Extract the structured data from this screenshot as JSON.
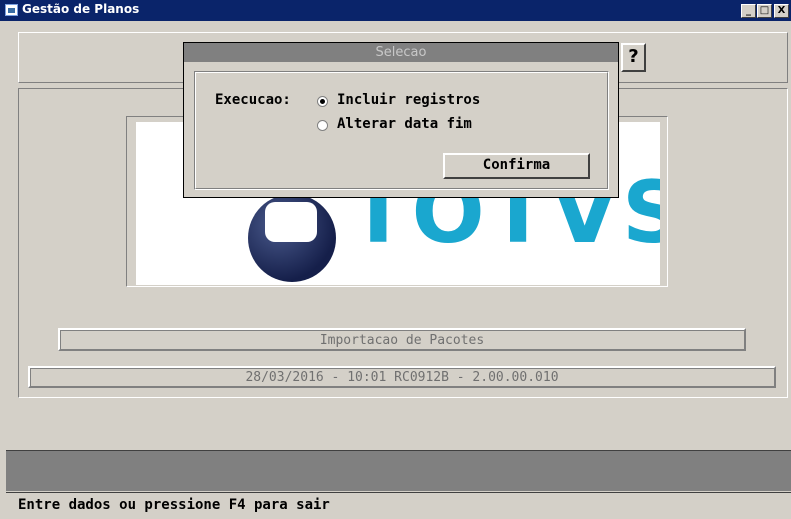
{
  "window": {
    "title": "Gestão de Planos",
    "controls": {
      "minimize": "_",
      "maximize": "□",
      "close": "X"
    }
  },
  "help_button": {
    "label": "?"
  },
  "main": {
    "logo_text": "TOTVS",
    "info_text": "Importacao de Pacotes",
    "version_text": "28/03/2016 - 10:01  RC0912B - 2.00.00.010"
  },
  "dialog": {
    "title": "Selecao",
    "field_label": "Execucao:",
    "options": [
      {
        "label": "Incluir registros",
        "selected": true
      },
      {
        "label": "Alterar data fim",
        "selected": false
      }
    ],
    "confirm_label": "Confirma"
  },
  "status": {
    "text": "Entre dados ou pressione F4 para sair"
  },
  "colors": {
    "titlebar": "#0a246a",
    "logo_text": "#1aa7cf",
    "logo_circle": "#151f4a",
    "window_bg": "#d4d0c8"
  }
}
